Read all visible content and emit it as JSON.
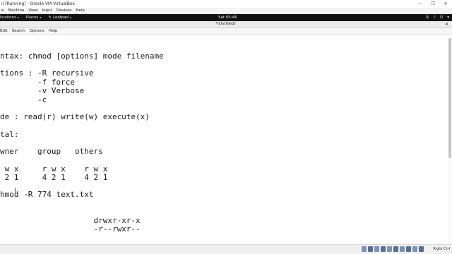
{
  "vbox": {
    "window_title": "ii [Running] - Oracle VM VirtualBox",
    "controls": {
      "minimize": "—",
      "maximize": "❐",
      "close": "✕"
    },
    "menu": [
      "Machine",
      "View",
      "Input",
      "Devices",
      "Help"
    ],
    "first_menu_partial": "e"
  },
  "gnome_panel": {
    "applications": "lications",
    "places": "Places",
    "app_menu": "Leafpad",
    "clock": "Sat 05:46"
  },
  "editor": {
    "title": "*(Untitled)",
    "menu": [
      "Edit",
      "Search",
      "Options",
      "Help"
    ],
    "lines": [
      "ntax: chmod [options] mode filename",
      "tions : -R recursive",
      "        -f force",
      "        -v Verbose",
      "        -c",
      "de : read(r) write(w) execute(x)",
      "tal:",
      "wner    group   others",
      " w x     r w x    r w x",
      " 2 1     4 2 1    4 2 1",
      "hmod -R 774 text.txt",
      "                    drwxr-xr-x",
      "                    -r--rwxr--"
    ]
  },
  "status": {
    "host_key": "Right Ctrl"
  }
}
